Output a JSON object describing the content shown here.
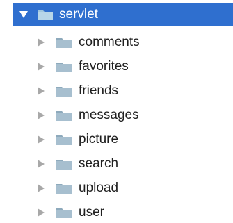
{
  "tree": {
    "root": {
      "label": "servlet",
      "expanded": true,
      "selected": true,
      "icon": "folder-icon",
      "expand_icon": "triangle-down-icon"
    },
    "children": [
      {
        "label": "comments"
      },
      {
        "label": "favorites"
      },
      {
        "label": "friends"
      },
      {
        "label": "messages"
      },
      {
        "label": "picture"
      },
      {
        "label": "search"
      },
      {
        "label": "upload"
      },
      {
        "label": "user"
      }
    ],
    "child_icon": "folder-icon",
    "collapse_icon": "triangle-right-icon"
  },
  "colors": {
    "selection": "#2f6fcf",
    "folder": "#9fb8c9",
    "arrow": "#a8a8a8",
    "text": "#1f1f1f"
  }
}
